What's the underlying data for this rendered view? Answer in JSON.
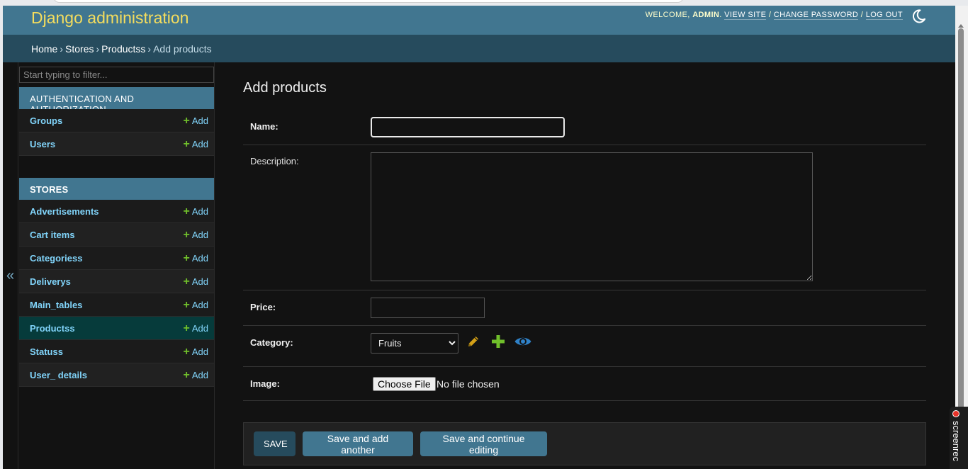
{
  "header": {
    "branding": "Django administration",
    "welcome": "WELCOME,",
    "user": "ADMIN",
    "view_site": "VIEW SITE",
    "change_password": "CHANGE PASSWORD",
    "log_out": "LOG OUT",
    "separator": "/",
    "theme_icon": "moon-icon"
  },
  "breadcrumbs": {
    "items": [
      "Home",
      "Stores",
      "Productss"
    ],
    "current": "Add products",
    "arrow": "›"
  },
  "nav_toggle": "«",
  "sidebar": {
    "filter_placeholder": "Start typing to filter...",
    "modules": [
      {
        "caption": "AUTHENTICATION AND AUTHORIZATION",
        "models": [
          {
            "name": "Groups",
            "add": "Add"
          },
          {
            "name": "Users",
            "add": "Add"
          }
        ]
      },
      {
        "caption": "STORES",
        "models": [
          {
            "name": "Advertisements",
            "add": "Add"
          },
          {
            "name": "Cart items",
            "add": "Add"
          },
          {
            "name": "Categoriess",
            "add": "Add"
          },
          {
            "name": "Deliverys",
            "add": "Add"
          },
          {
            "name": "Main_tables",
            "add": "Add"
          },
          {
            "name": "Productss",
            "add": "Add",
            "current": true
          },
          {
            "name": "Statuss",
            "add": "Add"
          },
          {
            "name": "User_ details",
            "add": "Add"
          }
        ]
      }
    ],
    "add_icon": "plus-icon"
  },
  "form": {
    "title": "Add products",
    "fields": {
      "name": {
        "label": "Name:",
        "value": ""
      },
      "description": {
        "label": "Description:",
        "value": ""
      },
      "price": {
        "label": "Price:",
        "value": ""
      },
      "category": {
        "label": "Category:",
        "selected": "Fruits",
        "options": [
          "Fruits"
        ]
      },
      "image": {
        "label": "Image:",
        "button": "Choose File",
        "status": "No file chosen"
      }
    },
    "related_icons": [
      "pencil-icon",
      "plus-icon",
      "eye-icon"
    ],
    "buttons": {
      "save": "SAVE",
      "save_add_another": "Save and add another",
      "save_continue": "Save and continue editing"
    }
  },
  "colors": {
    "header_bg": "#417690",
    "breadcrumbs_bg": "#264b5d",
    "branding": "#f5dd5d",
    "link": "#81d4fa",
    "add_plus": "#70bf2b",
    "current_row": "#063b3b",
    "page_bg": "#121212",
    "edit_icon": "#d4a017",
    "view_icon": "#2f81c7"
  },
  "overlay": {
    "recorder_label": "screenrec"
  }
}
